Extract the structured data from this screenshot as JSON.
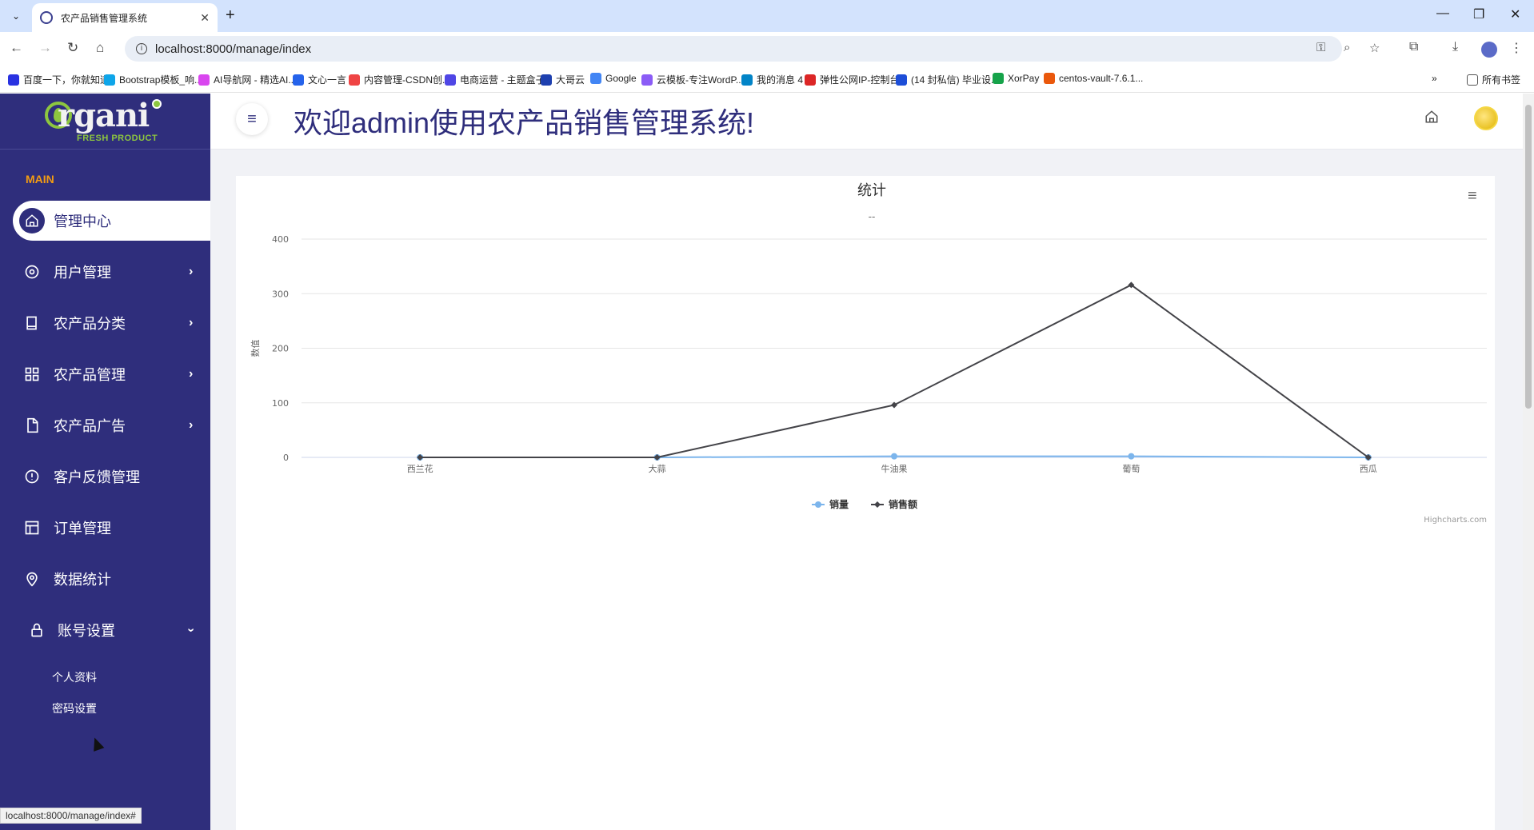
{
  "browser": {
    "tab_title": "农产品销售管理系统",
    "url": "localhost:8000/manage/index",
    "status_url": "localhost:8000/manage/index#",
    "bookmarks": [
      {
        "label": "百度一下，你就知道",
        "color": "#2932e1"
      },
      {
        "label": "Bootstrap模板_响...",
        "color": "#0ea5e9"
      },
      {
        "label": "AI导航网 - 精选AI...",
        "color": "#d946ef"
      },
      {
        "label": "文心一言",
        "color": "#2563eb"
      },
      {
        "label": "内容管理-CSDN创...",
        "color": "#ef4444"
      },
      {
        "label": "电商运营 - 主题盒子",
        "color": "#4f46e5"
      },
      {
        "label": "大哥云",
        "color": "#1e40af"
      },
      {
        "label": "Google",
        "color": "#4285f4"
      },
      {
        "label": "云模板-专注WordP...",
        "color": "#8b5cf6"
      },
      {
        "label": "我的消息 4",
        "color": "#0284c7"
      },
      {
        "label": "弹性公网IP-控制台",
        "color": "#dc2626"
      },
      {
        "label": "(14 封私信) 毕业设...",
        "color": "#1d4ed8"
      },
      {
        "label": "XorPay",
        "color": "#16a34a"
      },
      {
        "label": "centos-vault-7.6.1...",
        "color": "#ea580c"
      }
    ],
    "all_bookmarks": "所有书签"
  },
  "app": {
    "logo_text": "rgani",
    "logo_sub": "FRESH PRODUCT",
    "main_label": "MAIN",
    "welcome": "欢迎admin使用农产品销售管理系统!",
    "nav": [
      {
        "label": "管理中心",
        "icon": "home-icon"
      },
      {
        "label": "用户管理",
        "icon": "target-icon"
      },
      {
        "label": "农产品分类",
        "icon": "book-icon"
      },
      {
        "label": "农产品管理",
        "icon": "grid-icon"
      },
      {
        "label": "农产品广告",
        "icon": "file-icon"
      },
      {
        "label": "客户反馈管理",
        "icon": "alert-circle-icon"
      },
      {
        "label": "订单管理",
        "icon": "layout-icon"
      },
      {
        "label": "数据统计",
        "icon": "map-pin-icon"
      },
      {
        "label": "账号设置",
        "icon": "lock-icon"
      }
    ],
    "sub_nav": [
      "个人资料",
      "密码设置"
    ]
  },
  "chart_data": {
    "type": "line",
    "title": "统计",
    "subtitle": "--",
    "ylabel": "数值",
    "categories": [
      "西兰花",
      "大蒜",
      "牛油果",
      "葡萄",
      "西瓜"
    ],
    "ylim": [
      0,
      400
    ],
    "yticks": [
      0,
      100,
      200,
      300,
      400
    ],
    "series": [
      {
        "name": "销量",
        "values": [
          0,
          0,
          2,
          2,
          0
        ],
        "color": "#7cb5ec"
      },
      {
        "name": "销售额",
        "values": [
          0,
          0,
          96,
          316,
          0
        ],
        "color": "#434348"
      }
    ],
    "credits": "Highcharts.com",
    "grid": true,
    "legend": "bottom-center"
  }
}
